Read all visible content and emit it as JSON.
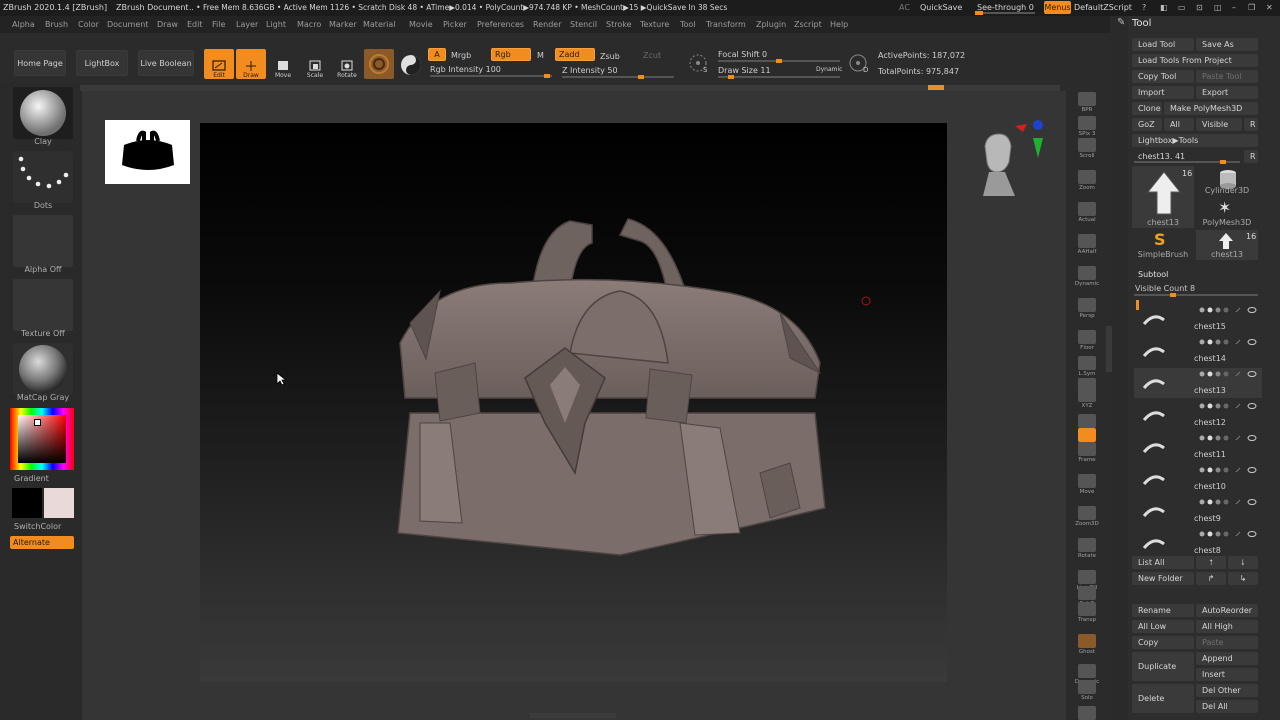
{
  "titlebar": {
    "app": "ZBrush 2020.1.4 [ZBrush]",
    "doc": "ZBrush Document",
    "stats": ".. • Free Mem 8.636GB • Active Mem 1126 • Scratch Disk 48 • ATime▶0.014 • PolyCount▶974.748 KP • MeshCount▶15 ▶QuickSave In 38 Secs",
    "ac": "AC",
    "quicksave": "QuickSave",
    "seethrough": "See-through  0",
    "menus": "Menus",
    "script": "DefaultZScript"
  },
  "menubar": [
    "Alpha",
    "Brush",
    "Color",
    "Document",
    "Draw",
    "Edit",
    "File",
    "Layer",
    "Light",
    "Macro",
    "Marker",
    "Material",
    "Movie",
    "Picker",
    "Preferences",
    "Render",
    "Stencil",
    "Stroke",
    "Texture",
    "Tool",
    "Transform",
    "Zplugin",
    "Zscript",
    "Help"
  ],
  "toolbar": {
    "home": "Home Page",
    "lightbox": "LightBox",
    "liveboolean": "Live Boolean",
    "edit": "Edit",
    "draw": "Draw",
    "move": "Move",
    "scale": "Scale",
    "rotate": "Rotate",
    "a": "A",
    "mrgb": "Mrgb",
    "rgb": "Rgb",
    "m": "M",
    "zadd": "Zadd",
    "zsub": "Zsub",
    "zcut": "Zcut",
    "rgb_intensity": "Rgb Intensity 100",
    "z_intensity_label": "Z Intensity",
    "z_intensity_value": "50",
    "focal_shift": "Focal Shift 0",
    "draw_size_label": "Draw Size",
    "draw_size_value": "11",
    "dynamic": "Dynamic",
    "active_points": "ActivePoints: 187,072",
    "total_points": "TotalPoints: 975,847",
    "s": "S",
    "d": "D"
  },
  "left": {
    "brush": "Clay",
    "stroke": "Dots",
    "alpha": "Alpha Off",
    "texture": "Texture Off",
    "material": "MatCap Gray",
    "gradient": "Gradient",
    "switchcolor": "SwitchColor",
    "alternate": "Alternate"
  },
  "rightstrip": [
    "BPR",
    "SPix 3",
    "Scroll",
    "Zoom",
    "Actual",
    "AAHalf",
    "Dynamic",
    "Persp",
    "Floor",
    "L.Sym",
    "",
    "XYZ",
    "",
    "",
    "Frame",
    "Move",
    "Zoom3D",
    "Rotate",
    "Line Fill",
    "PolyF",
    "Transp",
    "Ghost",
    "Dynamic",
    "Solo",
    "Xpose"
  ],
  "toolpanel": {
    "title": "Tool",
    "load_tool": "Load Tool",
    "save_as": "Save As",
    "load_from_project": "Load Tools From Project",
    "copy_tool": "Copy Tool",
    "paste_tool": "Paste Tool",
    "import": "Import",
    "export": "Export",
    "clone": "Clone",
    "make_polymesh": "Make PolyMesh3D",
    "goz": "GoZ",
    "all": "All",
    "visible": "Visible",
    "r": "R",
    "lightbox_tools": "Lightbox▶Tools",
    "current_tool": "chest13. 41",
    "r2": "R",
    "tools": [
      {
        "name": "chest13",
        "count": "16"
      },
      {
        "name": "Cylinder3D",
        "count": ""
      },
      {
        "name": "PolyMesh3D",
        "count": ""
      },
      {
        "name": "SimpleBrush",
        "count": ""
      },
      {
        "name": "chest13",
        "count": "16"
      }
    ],
    "subtool_title": "Subtool",
    "visible_count": "Visible Count 8",
    "subtools": [
      "chest15",
      "chest14",
      "chest13",
      "chest12",
      "chest11",
      "chest10",
      "chest9",
      "chest8"
    ],
    "list_all": "List All",
    "new_folder": "New Folder",
    "rename": "Rename",
    "autoreorder": "AutoReorder",
    "all_low": "All Low",
    "all_high": "All High",
    "copy": "Copy",
    "paste": "Paste",
    "duplicate": "Duplicate",
    "append": "Append",
    "insert": "Insert",
    "delete": "Delete",
    "del_other": "Del Other",
    "del_all": "Del All"
  },
  "colors": {
    "accent": "#f28c1e",
    "bg": "#2a2a2a",
    "mesh": "#7d6f6c"
  }
}
